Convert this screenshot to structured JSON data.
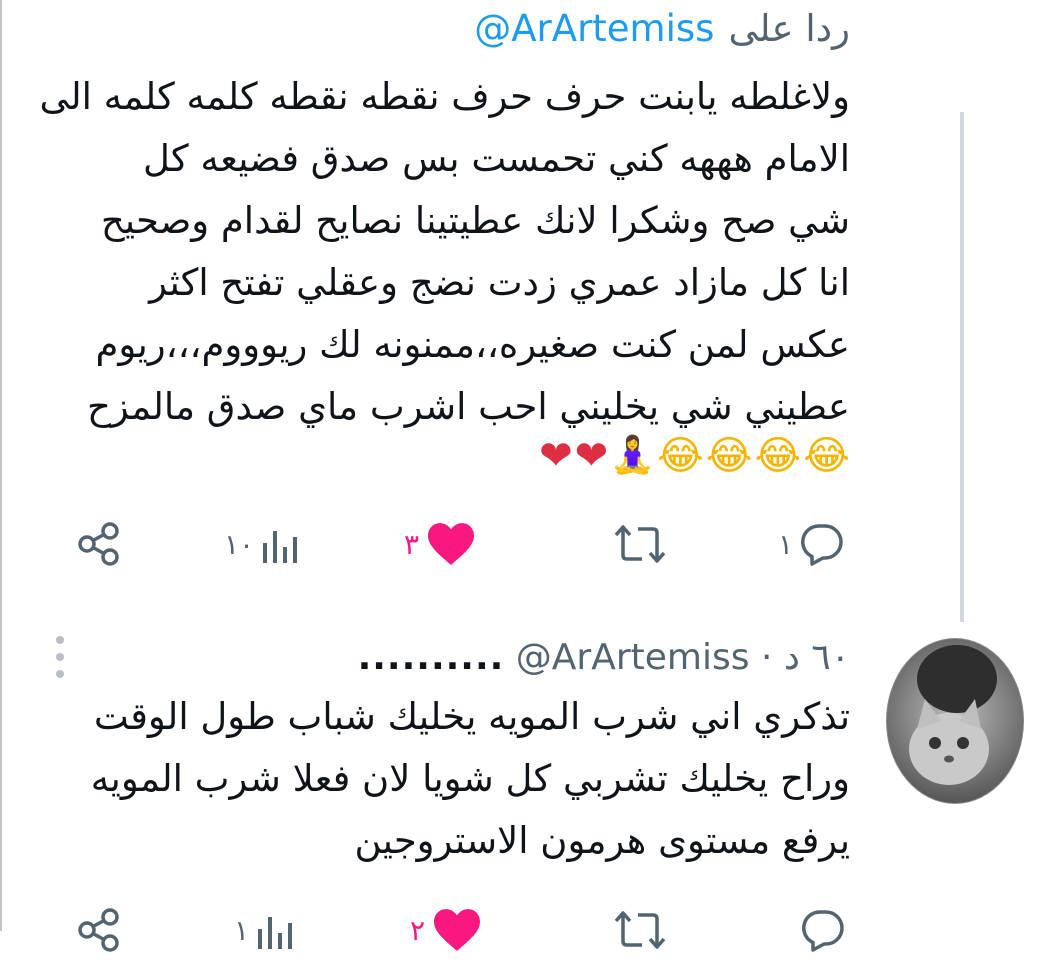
{
  "colors": {
    "link": "#1d9bf0",
    "secondary": "#536471",
    "like": "#f91880",
    "heart_emoji": "#dd2e44",
    "thread_line": "#cfd9de"
  },
  "reply_header": {
    "prefix": "ردا على",
    "handle": "@ArArtemiss"
  },
  "tweet1": {
    "lines": [
      "ولاغلطه يابنت حرف حرف نقطه نقطه كلمه كلمه الى",
      "الامام هههه كني تحمست بس صدق فضيعه كل",
      "شي صح وشكرا لانك عطيتينا نصايح لقدام وصحيح",
      "انا كل مازاد عمري زدت نضج وعقلي تفتح اكثر",
      "عكس لمن كنت صغيره،،ممنونه لك ريوووم،،،ريوم",
      "عطيني شي يخليني احب اشرب ماي صدق مالمزح"
    ],
    "emojis": [
      {
        "char": "😂",
        "icon": "face-with-tears-of-joy-icon",
        "kind": "laugh"
      },
      {
        "char": "😂",
        "icon": "face-with-tears-of-joy-icon",
        "kind": "laugh"
      },
      {
        "char": "😂",
        "icon": "face-with-tears-of-joy-icon",
        "kind": "laugh"
      },
      {
        "char": "😂",
        "icon": "face-with-tears-of-joy-icon",
        "kind": "laugh"
      },
      {
        "char": "🧘‍♀️",
        "icon": "woman-in-lotus-position-icon",
        "kind": "person"
      },
      {
        "char": "❤",
        "icon": "red-heart-icon",
        "kind": "heart"
      },
      {
        "char": "❤",
        "icon": "red-heart-icon",
        "kind": "heart"
      }
    ],
    "actions": {
      "replies": "١",
      "retweets": "",
      "likes": "٣",
      "views": "١٠",
      "liked": true
    }
  },
  "tweet2": {
    "author_name_dots": "..........",
    "handle": "@ArArtemiss",
    "separator": "·",
    "time": "٦٠ د",
    "lines": [
      "تذكري اني شرب المويه يخليك شباب طول الوقت",
      "وراح يخليك تشربي كل شويا لان فعلا شرب المويه",
      "يرفع مستوى هرمون الاستروجين"
    ],
    "actions": {
      "replies": "",
      "retweets": "",
      "likes": "٢",
      "views": "١",
      "liked": true
    }
  },
  "icons": {
    "reply": "reply-icon",
    "retweet": "retweet-icon",
    "like": "heart-icon",
    "views": "views-chart-icon",
    "share": "share-icon",
    "more": "more-options-icon"
  }
}
